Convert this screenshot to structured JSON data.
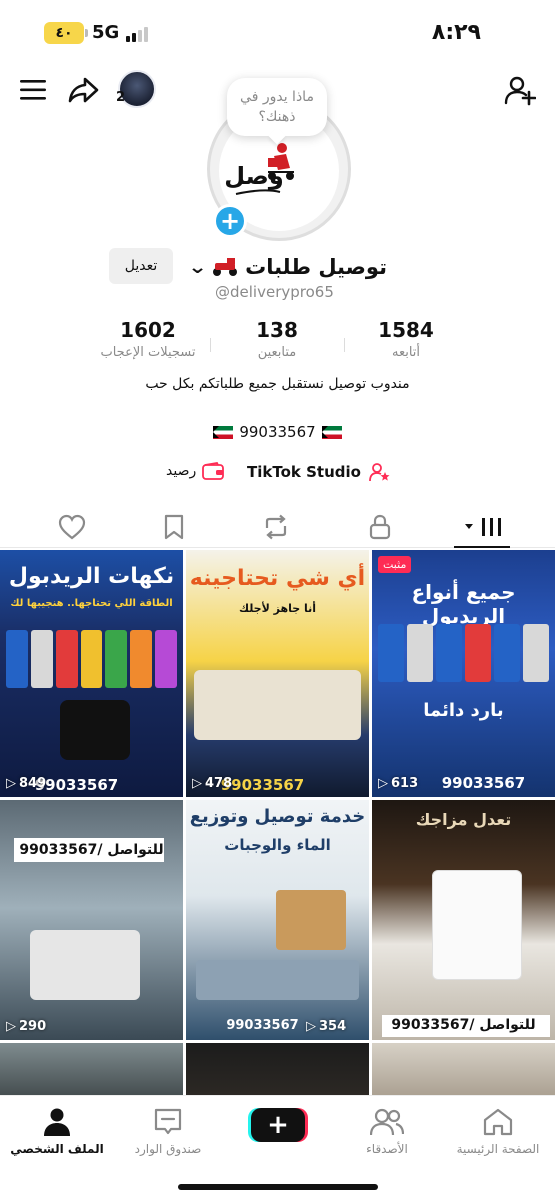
{
  "status_bar": {
    "battery": "٤٠",
    "network": "5G",
    "time": "٨:٢٩"
  },
  "top_bar": {
    "story_count": "2",
    "icons": [
      "menu-icon",
      "share-icon",
      "add-friend-icon"
    ]
  },
  "profile": {
    "bubble_text": "ماذا يدور في ذهنك؟",
    "avatar_text": "وصل",
    "display_name": "توصيل طلبات",
    "username": "@deliverypro65",
    "edit_label": "تعديل",
    "stats": {
      "following": {
        "value": "1584",
        "label": "أتابعه"
      },
      "followers": {
        "value": "138",
        "label": "متابعين"
      },
      "likes": {
        "value": "1602",
        "label": "تسجيلات الإعجاب"
      }
    },
    "bio": "مندوب توصيل نستقبل جميع طلباتكم بكل حب",
    "phone": "99033567",
    "studio_label": "TikTok Studio",
    "wallet_label": "رصيد"
  },
  "grid": {
    "pinned_label": "مثبت",
    "items": [
      {
        "views": "849",
        "caption": "نكهات الريدبول",
        "subcaption": "الطاقة اللي تحتاجها.. هنجيبها لك",
        "phone": "99033567"
      },
      {
        "views": "478",
        "caption": "أي شي تحتاجينه",
        "subcaption": "أنا جاهز لأجلك",
        "phone": "99033567"
      },
      {
        "views": "613",
        "caption": "جميع أنواع الريدبول",
        "subcaption": "بارد دائما",
        "phone": "99033567",
        "pinned": true
      },
      {
        "views": "290",
        "caption": "للتواصل /99033567"
      },
      {
        "views": "354",
        "caption": "خدمة توصيل وتوزيع",
        "subcaption": "الماء والوجبات",
        "phone": "99033567"
      },
      {
        "views": "",
        "caption": "للتواصل /99033567",
        "subcaption": "تعدل مزاجك"
      }
    ]
  },
  "bottom_nav": {
    "home": "الصفحة الرئيسية",
    "friends": "الأصدقاء",
    "inbox": "صندوق الوارد",
    "profile": "الملف الشخصي"
  },
  "colors": {
    "accent": "#fe2c55",
    "cyan": "#25f4ee",
    "avatar_add": "#27a7e7"
  }
}
